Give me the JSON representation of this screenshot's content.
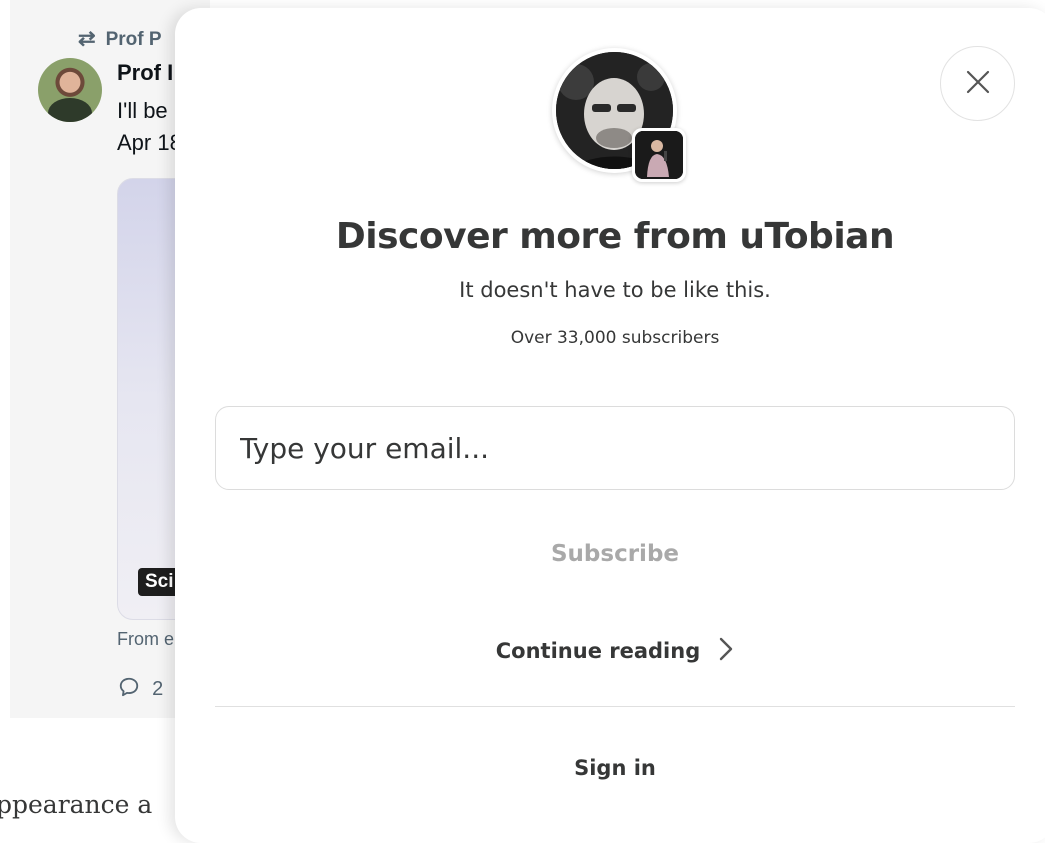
{
  "background": {
    "retweet_icon": "retweet-icon",
    "retweet_text": "Prof P",
    "author_name": "Prof I",
    "tweet_text": "I'll be",
    "tweet_date": "Apr 18",
    "media_tag": "Sci",
    "from_text": "From e",
    "reply_icon": "reply-bubble-icon",
    "reply_count": "2",
    "article_text": "ppearance a"
  },
  "modal": {
    "title": "Discover more from uTobian",
    "subtitle": "It doesn't have to be like this.",
    "subscriber_count": "Over 33,000 subscribers",
    "email_placeholder": "Type your email...",
    "subscribe_label": "Subscribe",
    "continue_label": "Continue reading",
    "signin_label": "Sign in",
    "close_icon": "close-icon",
    "chevron_icon": "chevron-right-icon"
  },
  "colors": {
    "text": "#363737",
    "disabled_text": "#a9a9a9",
    "border": "#dcdcdc",
    "muted_gray": "#536471"
  }
}
